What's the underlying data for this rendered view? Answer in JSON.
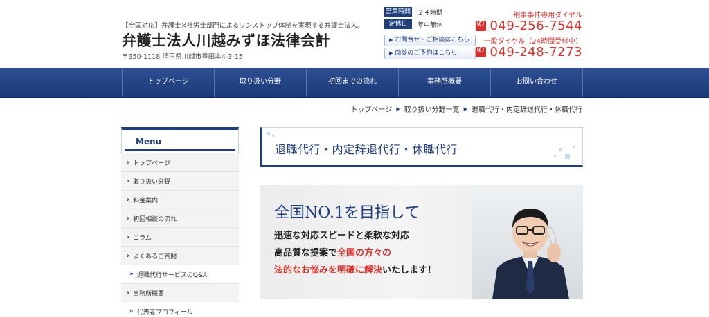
{
  "header": {
    "tagline": "【全国対応】弁護士×社労士部門によるワンストップ体制を実現する弁護士法人。",
    "title": "弁護士法人川越みずほ法律会計",
    "address": "〒350-1118 埼玉県川越市豊田本4-3-15",
    "hours": [
      {
        "label": "営業時間",
        "value": "２４時間"
      },
      {
        "label": "定休日",
        "value": "年中無休"
      }
    ],
    "links": [
      {
        "label": "お問合せ・ご相談はこちら"
      },
      {
        "label": "面談のご予約はこちら"
      }
    ],
    "phones": [
      {
        "label": "刑事事件専用ダイヤル",
        "number": "049-256-7544"
      },
      {
        "label": "一般ダイヤル（24時間受付中）",
        "number": "049-248-7273"
      }
    ]
  },
  "nav": {
    "items": [
      "トップページ",
      "取り扱い分野",
      "初回までの流れ",
      "事務所概要",
      "お問い合わせ"
    ]
  },
  "breadcrumb": [
    "トップページ",
    "取り扱い分野一覧",
    "退職代行・内定辞退代行・休職代行"
  ],
  "sidebar": {
    "heading": "Menu",
    "items": [
      {
        "label": "トップページ"
      },
      {
        "label": "取り扱い分野"
      },
      {
        "label": "料金案内"
      },
      {
        "label": "初回相談の流れ"
      },
      {
        "label": "コラム"
      },
      {
        "label": "よくあるご質問"
      },
      {
        "label": "退職代行サービスのQ&A"
      },
      {
        "label": "事務所概要"
      },
      {
        "label": "代表者プロフィール"
      }
    ]
  },
  "main": {
    "page_title": "退職代行・内定辞退代行・休職代行",
    "banner": {
      "line1": "全国NO.1を目指して",
      "line2": "迅速な対応スピードと柔軟な対応",
      "line3_a": "高品質な提案で",
      "line3_b": "全国の方々の",
      "line4_a": "法的なお悩みを明確に解決",
      "line4_b": "いたします！"
    }
  },
  "colors": {
    "navy": "#1e3e7e",
    "red": "#d9302c"
  }
}
